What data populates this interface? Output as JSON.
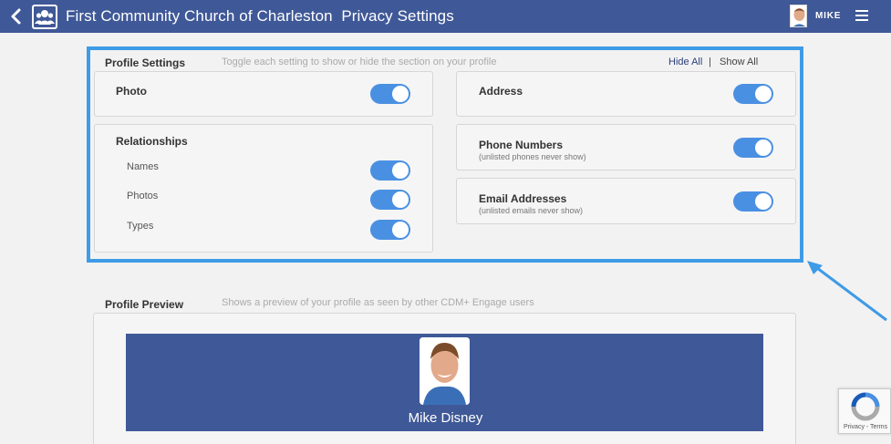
{
  "header": {
    "title": "First Community Church of Charleston  Privacy Settings",
    "user_name": "MIKE"
  },
  "profile_settings": {
    "title": "Profile Settings",
    "description": "Toggle each setting to show or hide the section on your profile",
    "hide_all": "Hide All",
    "separator": "|",
    "show_all": "Show All",
    "photo_label": "Photo",
    "relationships": {
      "label": "Relationships",
      "names": "Names",
      "photos": "Photos",
      "types": "Types"
    },
    "address_label": "Address",
    "phone_label": "Phone Numbers",
    "phone_note": "(unlisted phones never show)",
    "email_label": "Email Addresses",
    "email_note": "(unlisted emails never show)"
  },
  "toggles": {
    "photo": true,
    "names": true,
    "photos": true,
    "types": true,
    "address": true,
    "phone": true,
    "email": true
  },
  "profile_preview": {
    "title": "Profile Preview",
    "description": "Shows a preview of your profile as seen by other CDM+ Engage users",
    "name": "Mike Disney"
  },
  "recaptcha": {
    "text": "Privacy - Terms"
  },
  "colors": {
    "header_bg": "#3f5897",
    "highlight": "#3e9be6",
    "toggle_on": "#4a90e2"
  }
}
